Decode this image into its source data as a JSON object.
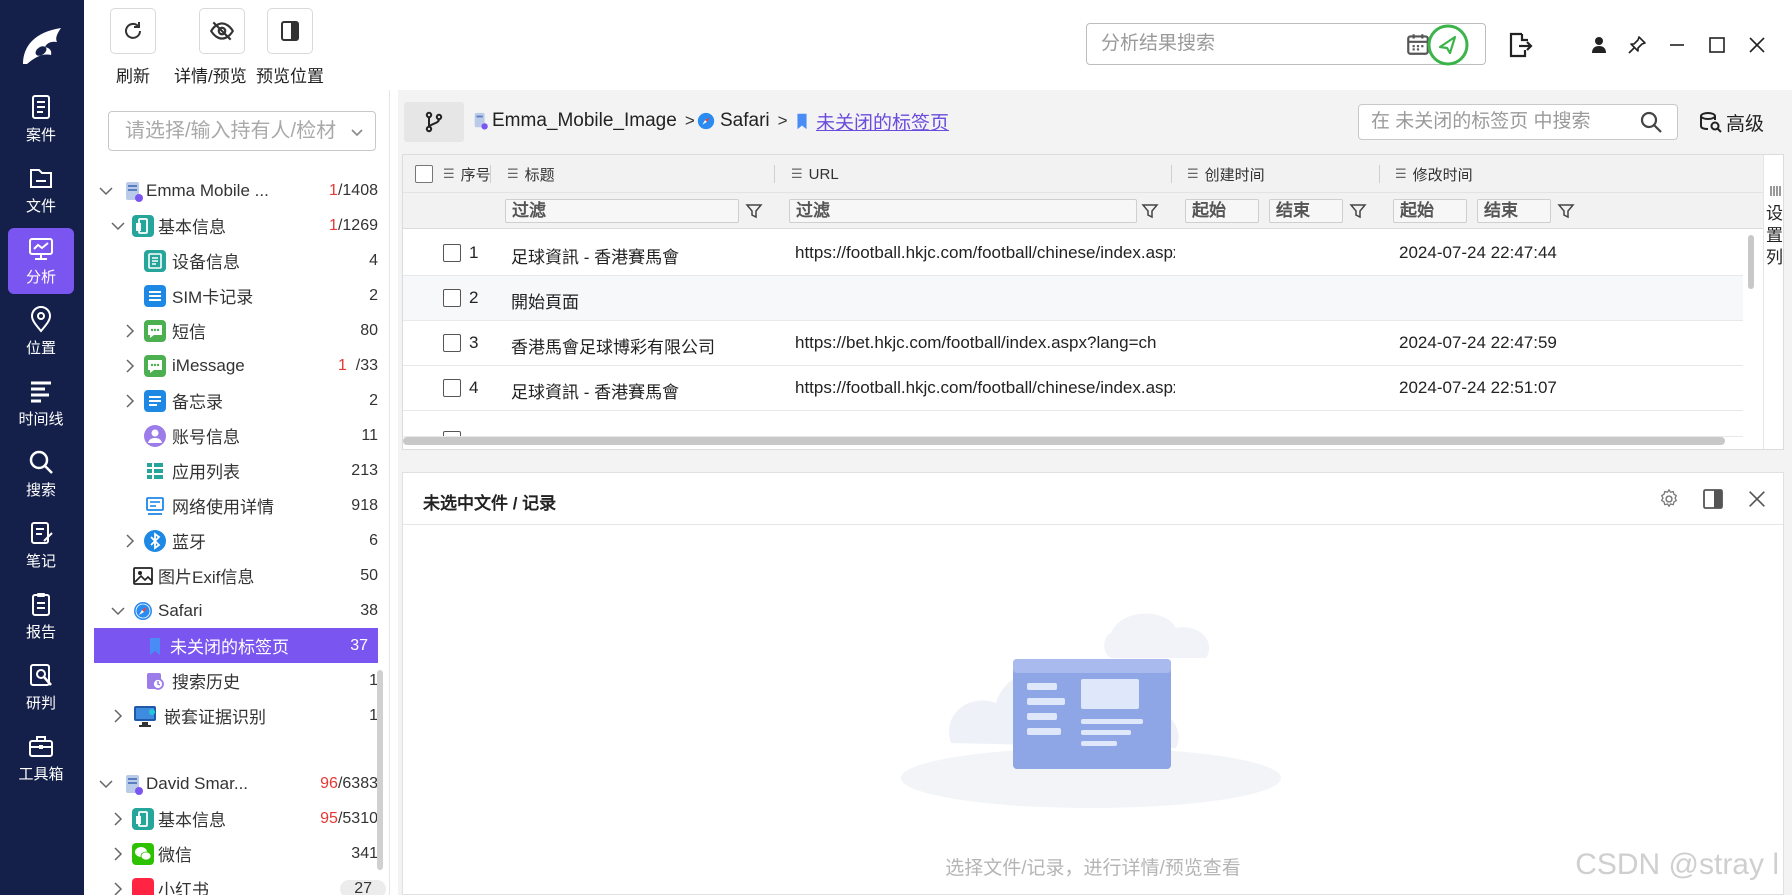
{
  "rail": {
    "items": [
      {
        "label": "案件",
        "icon": "case-icon"
      },
      {
        "label": "文件",
        "icon": "file-icon"
      },
      {
        "label": "分析",
        "icon": "analysis-icon",
        "active": true
      },
      {
        "label": "位置",
        "icon": "location-icon"
      },
      {
        "label": "时间线",
        "icon": "timeline-icon"
      },
      {
        "label": "搜索",
        "icon": "search-icon"
      },
      {
        "label": "笔记",
        "icon": "note-icon"
      },
      {
        "label": "报告",
        "icon": "report-icon"
      },
      {
        "label": "研判",
        "icon": "judge-icon"
      },
      {
        "label": "工具箱",
        "icon": "toolbox-icon"
      }
    ]
  },
  "toolbar": {
    "refresh_label": "刷新",
    "detail_label": "详情/预览",
    "position_label": "预览位置",
    "search_placeholder": "分析结果搜索"
  },
  "tree": {
    "select_placeholder": "请选择/输入持有人/检材",
    "nodes": [
      {
        "label": "Emma Mobile ...",
        "count_red": "1",
        "count": "/1408"
      },
      {
        "label": "基本信息",
        "count_red": "1",
        "count": "/1269"
      },
      {
        "label": "设备信息",
        "count": "4"
      },
      {
        "label": "SIM卡记录",
        "count": "2"
      },
      {
        "label": "短信",
        "count": "80"
      },
      {
        "label": "iMessage",
        "count_red": "1",
        "count": "/33"
      },
      {
        "label": "备忘录",
        "count": "2"
      },
      {
        "label": "账号信息",
        "count": "11"
      },
      {
        "label": "应用列表",
        "count": "213"
      },
      {
        "label": "网络使用详情",
        "count": "918"
      },
      {
        "label": "蓝牙",
        "count": "6"
      },
      {
        "label": "图片Exif信息",
        "count": "50"
      },
      {
        "label": "Safari",
        "count": "38"
      },
      {
        "label": "未关闭的标签页",
        "count": "37"
      },
      {
        "label": "搜索历史",
        "count": "1"
      },
      {
        "label": "嵌套证据识别",
        "count": "1"
      },
      {
        "label": "David Smar...",
        "count_red": "96",
        "count": "/6383"
      },
      {
        "label": "基本信息",
        "count_red": "95",
        "count": "/5310"
      },
      {
        "label": "微信",
        "count": "341"
      },
      {
        "label": "小红书",
        "count": "27"
      }
    ]
  },
  "breadcrumb": {
    "items": [
      "Emma_Mobile_Image",
      "Safari",
      "未关闭的标签页"
    ],
    "separator": ">"
  },
  "table_search": {
    "placeholder": "在 未关闭的标签页 中搜索"
  },
  "advanced_label": "高级",
  "table": {
    "columns": [
      "序号",
      "标题",
      "URL",
      "创建时间",
      "修改时间"
    ],
    "filter_placeholder": "过滤",
    "start_placeholder": "起始",
    "end_placeholder": "结束",
    "rows": [
      {
        "index": "1",
        "title": "足球資訊 - 香港賽馬會",
        "url": "https://football.hkjc.com/football/chinese/index.aspx",
        "created": "",
        "modified": "2024-07-24 22:47:44"
      },
      {
        "index": "2",
        "title": "開始頁面",
        "url": "",
        "created": "",
        "modified": ""
      },
      {
        "index": "3",
        "title": "香港馬會足球博彩有限公司",
        "url": "https://bet.hkjc.com/football/index.aspx?lang=ch",
        "created": "",
        "modified": "2024-07-24 22:47:59"
      },
      {
        "index": "4",
        "title": "足球資訊 - 香港賽馬會",
        "url": "https://football.hkjc.com/football/chinese/index.aspx",
        "created": "",
        "modified": "2024-07-24 22:51:07"
      }
    ],
    "set_columns_label": [
      "设",
      "置",
      "列"
    ]
  },
  "preview": {
    "title": "未选中文件 / 记录",
    "empty_hint": "选择文件/记录，进行详情/预览查看"
  },
  "watermark": "CSDN @stray l",
  "colors": {
    "rail_bg": "#14204a",
    "accent": "#7b55f0",
    "red": "#e53935",
    "green": "#3cb44b"
  }
}
